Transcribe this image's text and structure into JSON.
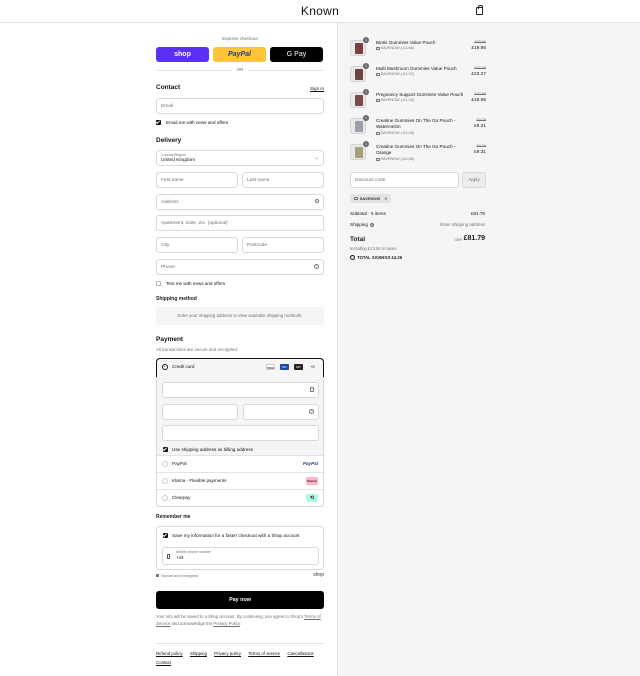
{
  "header": {
    "logo": "Known"
  },
  "express": {
    "label": "Express checkout",
    "shop": "shop",
    "paypal": "PayPal",
    "gpay": "G Pay",
    "or": "OR"
  },
  "contact": {
    "title": "Contact",
    "sign_in": "Sign in",
    "email_placeholder": "Email",
    "news_label": "Email me with news and offers"
  },
  "delivery": {
    "title": "Delivery",
    "country_label": "Country/Region",
    "country_value": "United Kingdom",
    "first_name": "First name",
    "last_name": "Last name",
    "address": "Address",
    "apartment": "Apartment, suite, etc. (optional)",
    "city": "City",
    "postcode": "Postcode",
    "phone": "Phone",
    "text_label": "Text me with news and offers"
  },
  "shipping_method": {
    "title": "Shipping method",
    "message": "Enter your shipping address to view available shipping methods."
  },
  "payment": {
    "title": "Payment",
    "subtitle": "All transactions are secure and encrypted.",
    "credit_card": "Credit card",
    "more_cards": "+5",
    "card_logos": [
      "VISA",
      "MC",
      "MC"
    ],
    "billing_same": "Use shipping address as billing address",
    "paypal": "PayPal",
    "paypal_logo": "PayPal",
    "klarna": "Klarna - Flexible payments",
    "klarna_logo": "Klarna",
    "clearpay": "Clearpay",
    "clearpay_logo": "⟲"
  },
  "remember": {
    "title": "Remember me",
    "save_label": "Save my information for a faster checkout with a Shop account",
    "mobile_label": "Mobile phone number",
    "mobile_value": "+44",
    "secure": "Secure and encrypted",
    "shop": "shop"
  },
  "pay_now": "Pay now",
  "legal": {
    "text": "Your info will be saved to a Shop account. By continuing, you agree to Shop's",
    "tos": "Terms of Service",
    "and": "and acknowledge the",
    "privacy": "Privacy Policy",
    "end": "."
  },
  "footer": {
    "links": [
      "Refund policy",
      "Shipping",
      "Privacy policy",
      "Terms of service",
      "Cancellations",
      "Contact"
    ]
  },
  "cart": {
    "items": [
      {
        "qty": "1",
        "name": "Biotin Gummies Value Pouch",
        "discount": "SAVENOW (-£1.66)",
        "old": "£20.60",
        "price": "£19.95",
        "color": "#7a3f3f"
      },
      {
        "qty": "1",
        "name": "Multi Mushroom Gummies Value Pouch",
        "discount": "SAVENOW (-£1.22)",
        "old": "£24.49",
        "price": "£23.27",
        "color": "#6b4540"
      },
      {
        "qty": "1",
        "name": "Pregnancy Support Gummies Value Pouch",
        "discount": "SAVENOW (-£1.04)",
        "old": "£20.99",
        "price": "£19.95",
        "color": "#7a4a4a"
      },
      {
        "qty": "1",
        "name": "Creatine Gummies On The Go Pouch - Watermelon",
        "discount": "SAVENOW (-£0.48)",
        "old": "£9.79",
        "price": "£9.31",
        "color": "#9aa0a8"
      },
      {
        "qty": "1",
        "name": "Creatine Gummies On The Go Pouch - Orange",
        "discount": "SAVENOW (-£0.48)",
        "old": "£9.79",
        "price": "£9.31",
        "color": "#a6a07a"
      }
    ],
    "discount_placeholder": "Discount code",
    "apply": "Apply",
    "code": "SAVENOW",
    "subtotal_label": "Subtotal · 5 items",
    "subtotal": "£81.79",
    "shipping_label": "Shipping",
    "shipping_value": "Enter shipping address",
    "total_label": "Total",
    "currency": "GBP",
    "total": "£81.79",
    "taxes": "Including £13.64 in taxes",
    "savings_label": "TOTAL SAVINGS",
    "savings": "£4.26"
  }
}
